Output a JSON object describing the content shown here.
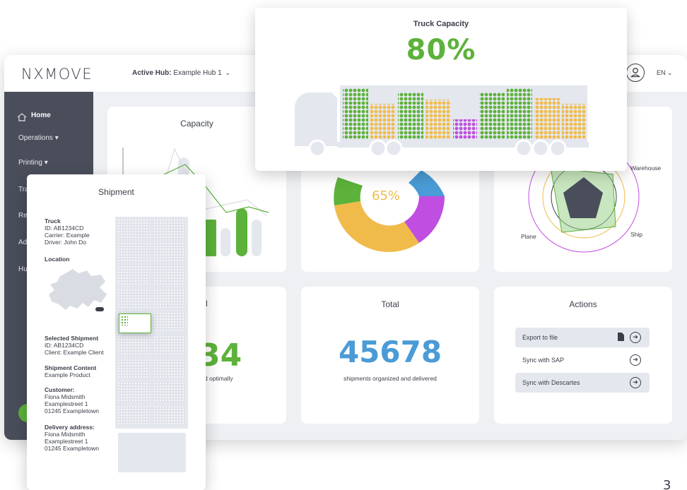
{
  "app": {
    "logo": "NXMOVE",
    "hub_label": "Active Hub:",
    "hub_value": "Example Hub 1",
    "language": "EN",
    "colors": {
      "accent_green": "#5cb23a",
      "accent_orange": "#f0bb4a",
      "accent_blue": "#4a9bd6",
      "accent_purple": "#c04ee0",
      "sidebar": "#4a4e5b"
    }
  },
  "sidebar": {
    "items": [
      {
        "label": "Home",
        "icon": "home-icon"
      },
      {
        "label": "Operations",
        "icon": "chevron-down-icon"
      },
      {
        "label": "Printing",
        "icon": "chevron-down-icon"
      },
      {
        "label": "Tra"
      },
      {
        "label": "Re"
      },
      {
        "label": "Ad"
      },
      {
        "label": "Hu"
      }
    ]
  },
  "cards": {
    "capacity": {
      "title": "Capacity"
    },
    "donut": {
      "value_label": "65%",
      "value": 65
    },
    "radar": {
      "labels": [
        "Warehouse",
        "Plane",
        "Ship"
      ]
    },
    "optimal": {
      "title_fragment": "l",
      "value_fragment": "34",
      "sub_fragment": "d optimally"
    },
    "total": {
      "title": "Total",
      "value": "45678",
      "sub": "shipments organized and delivered"
    },
    "actions": {
      "title": "Actions",
      "items": [
        {
          "label": "Export to file"
        },
        {
          "label": "Sync with SAP"
        },
        {
          "label": "Sync with Descartes"
        }
      ]
    }
  },
  "truck_capacity": {
    "title": "Truck Capacity",
    "value_label": "80%",
    "value": 80
  },
  "shipment": {
    "title": "Shipment",
    "truck": {
      "heading": "Truck",
      "id": "ID: AB1234CD",
      "carrier": "Carrier: Example",
      "driver": "Driver: John Do"
    },
    "location": {
      "heading": "Location"
    },
    "selected": {
      "heading": "Selected Shipment",
      "id": "ID: AB1234CD",
      "client": "Client: Example Client"
    },
    "content": {
      "heading": "Shipment Content",
      "value": "Example Product"
    },
    "customer": {
      "heading": "Customer:",
      "name": "Fiona Midsmith",
      "street": "Examplestreet 1",
      "city": "01245 Exampletown"
    },
    "delivery": {
      "heading": "Delivery address:",
      "name": "Fiona Midsmith",
      "street": "Examplestreet 1",
      "city": "01245 Exampletown"
    }
  },
  "page_number": "3"
}
